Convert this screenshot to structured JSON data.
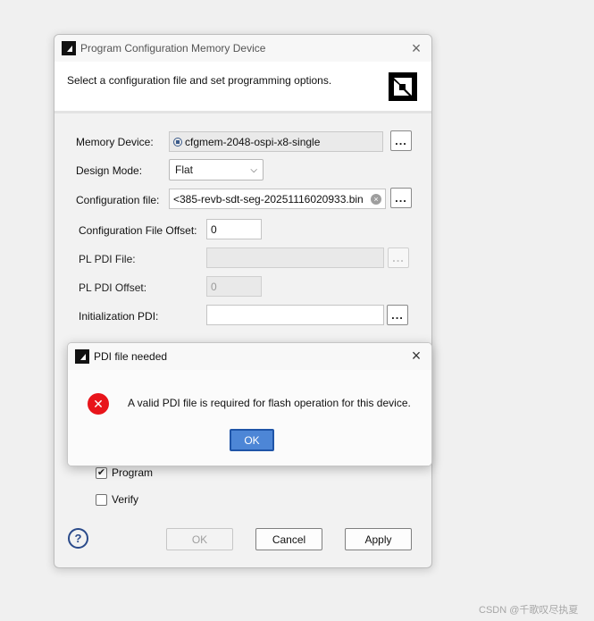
{
  "main_dialog": {
    "title": "Program Configuration Memory Device",
    "instruction": "Select a configuration file and set programming options.",
    "memory_device": {
      "label": "Memory Device:",
      "value": "cfgmem-2048-ospi-x8-single"
    },
    "design_mode": {
      "label": "Design Mode:",
      "value": "Flat"
    },
    "configuration_file": {
      "label": "Configuration file:",
      "value": "<385-revb-sdt-seg-20251116020933.bin"
    },
    "configuration_file_offset": {
      "label": "Configuration File Offset:",
      "value": "0"
    },
    "pl_pdi_file": {
      "label": "PL PDI File:",
      "value": ""
    },
    "pl_pdi_offset": {
      "label": "PL PDI Offset:",
      "value": "0"
    },
    "initialization_pdi": {
      "label": "Initialization PDI:",
      "value": ""
    },
    "browse_label": "...",
    "program": {
      "label": "Program",
      "checked": true
    },
    "verify": {
      "label": "Verify",
      "checked": false
    },
    "buttons": {
      "ok": "OK",
      "cancel": "Cancel",
      "apply": "Apply"
    },
    "help_label": "?"
  },
  "message_dialog": {
    "title": "PDI file needed",
    "message": "A valid PDI file is required for flash operation for this device.",
    "ok": "OK"
  },
  "watermark": "CSDN @千歌叹尽执夏",
  "colors": {
    "error": "#e8141a",
    "primary_button": "#4d86d6",
    "primary_border": "#1f55a8"
  }
}
